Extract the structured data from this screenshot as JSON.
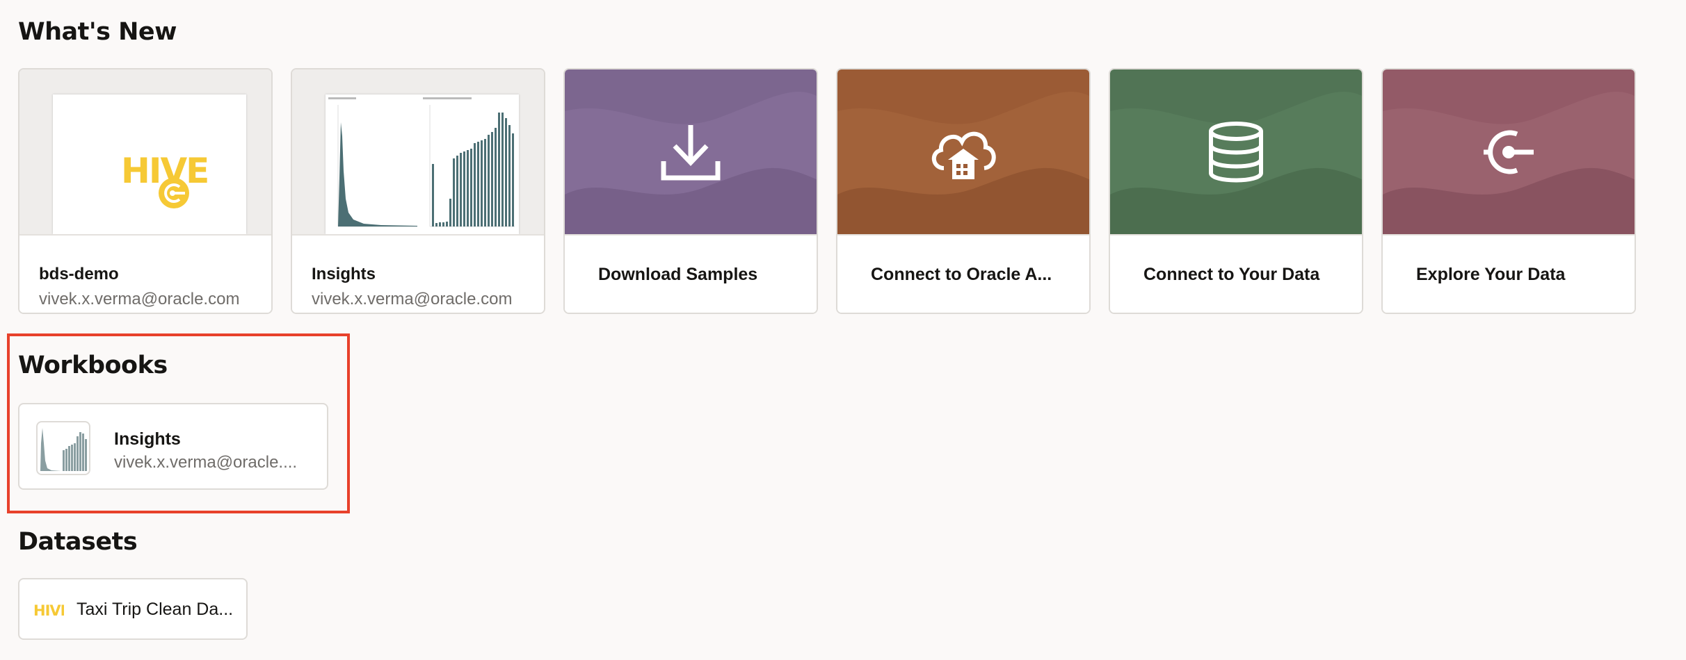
{
  "whats_new": {
    "heading": "What's New",
    "cards": [
      {
        "title": "bds-demo",
        "subtitle": "vivek.x.verma@oracle.com",
        "icon": "hive-logo"
      },
      {
        "title": "Insights",
        "subtitle": "vivek.x.verma@oracle.com",
        "icon": "chart-thumbnail"
      },
      {
        "title": "Download Samples",
        "icon": "download-icon",
        "color": "#7c668f"
      },
      {
        "title": "Connect to Oracle A...",
        "icon": "cloud-warehouse-icon",
        "color": "#9b5b35"
      },
      {
        "title": "Connect to Your Data",
        "icon": "database-icon",
        "color": "#517455"
      },
      {
        "title": "Explore Your Data",
        "icon": "explore-icon",
        "color": "#935a67"
      }
    ]
  },
  "workbooks": {
    "heading": "Workbooks",
    "items": [
      {
        "title": "Insights",
        "subtitle": "vivek.x.verma@oracle...."
      }
    ]
  },
  "datasets": {
    "heading": "Datasets",
    "items": [
      {
        "title": "Taxi Trip Clean Da...",
        "logo_text": "HIVE"
      }
    ]
  },
  "colors": {
    "accent_highlight": "#e8412b",
    "hive_yellow": "#f6c935",
    "chart_teal": "#4c6f74"
  }
}
